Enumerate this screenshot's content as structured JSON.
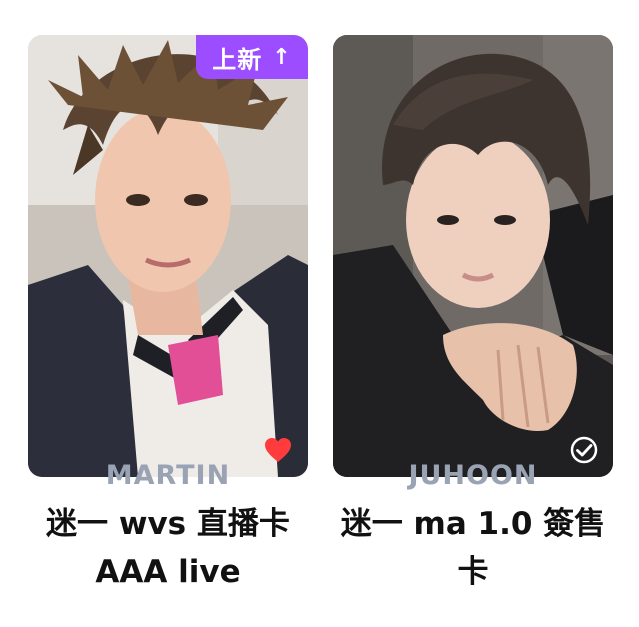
{
  "cards": [
    {
      "badge": {
        "label": "上新",
        "arrow": "↑"
      },
      "artist": "MARTIN",
      "title_line1": "迷一 wvs 直播卡",
      "title_line2": "AAA live",
      "favorite_icon": "heart-icon",
      "favorite_color": "#ff3b3b"
    },
    {
      "artist": "JUHOON",
      "title_line1": "迷一 ma 1.0 簽售",
      "title_line2": "卡",
      "status_icon": "check-circle-icon"
    }
  ],
  "colors": {
    "badge": "#9b4dff",
    "artist": "#9aa3b3",
    "title": "#111111"
  }
}
